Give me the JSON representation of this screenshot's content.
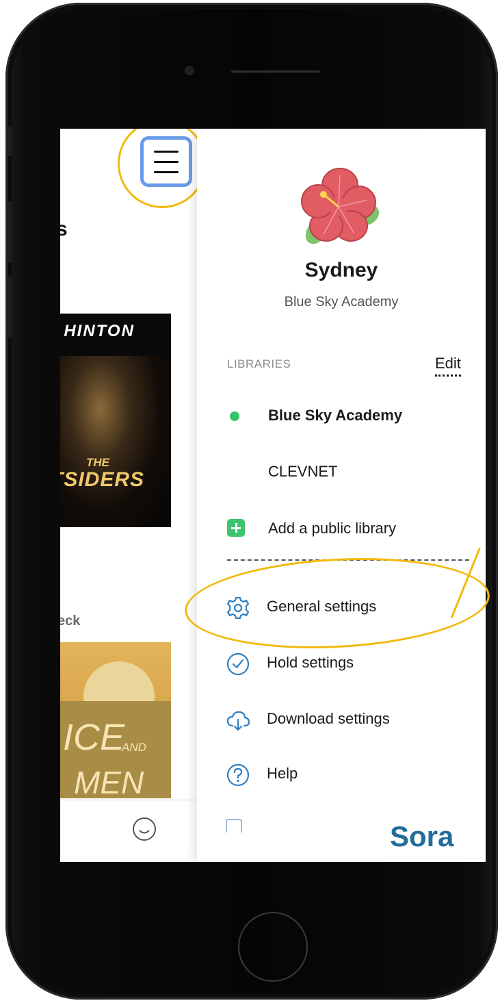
{
  "background_app": {
    "title_fragment": "s",
    "cover1": {
      "author_fragment": ". HINTON",
      "the": "THE",
      "title_fragment": "TSIDERS"
    },
    "section_fragment": "eck",
    "cover2": {
      "text1": "ICE",
      "and": "AND",
      "text2": "MEN"
    }
  },
  "drawer": {
    "user": {
      "name": "Sydney",
      "school": "Blue Sky Academy"
    },
    "libraries": {
      "header": "LIBRARIES",
      "edit_label": "Edit",
      "items": [
        {
          "label": "Blue Sky Academy",
          "active": true
        },
        {
          "label": "CLEVNET",
          "active": false
        }
      ],
      "add_label": "Add a public library"
    },
    "settings": [
      {
        "label": "General settings",
        "icon": "gear-icon"
      },
      {
        "label": "Hold settings",
        "icon": "check-circle-icon"
      },
      {
        "label": "Download settings",
        "icon": "cloud-download-icon"
      },
      {
        "label": "Help",
        "icon": "help-icon"
      }
    ],
    "brand": "Sora"
  },
  "colors": {
    "highlight": "#f2b90c",
    "menu_border": "#6a9be8",
    "accent_green": "#35c46a",
    "icon_blue": "#2f7fc2",
    "brand_blue": "#246c9c"
  }
}
